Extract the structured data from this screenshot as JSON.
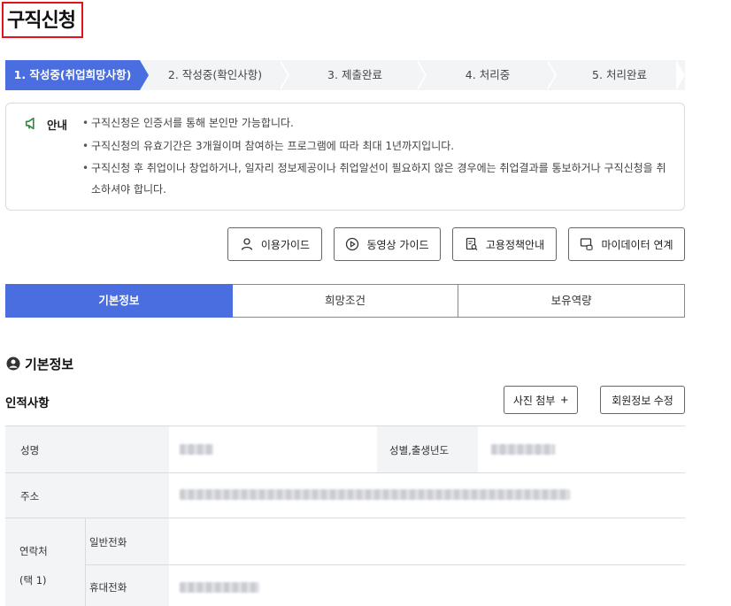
{
  "page": {
    "title": "구직신청"
  },
  "steps": [
    {
      "label": "1. 작성중(취업희망사항)",
      "active": true
    },
    {
      "label": "2. 작성중(확인사항)",
      "active": false
    },
    {
      "label": "3. 제출완료",
      "active": false
    },
    {
      "label": "4. 처리중",
      "active": false
    },
    {
      "label": "5. 처리완료",
      "active": false
    }
  ],
  "notice": {
    "label": "안내",
    "items": [
      "구직신청은 인증서를 통해 본인만 가능합니다.",
      "구직신청의 유효기간은 3개월이며 참여하는 프로그램에 따라 최대 1년까지입니다.",
      "구직신청 후 취업이나 창업하거나, 일자리 정보제공이나 취업알선이 필요하지 않은 경우에는 취업결과를 통보하거나 구직신청을 취",
      "소하셔야 합니다."
    ]
  },
  "guide_buttons": {
    "usage": "이용가이드",
    "video": "동영상 가이드",
    "policy": "고용정책안내",
    "mydata": "마이데이터 연계"
  },
  "tabs": [
    {
      "label": "기본정보",
      "active": true
    },
    {
      "label": "희망조건",
      "active": false
    },
    {
      "label": "보유역량",
      "active": false
    }
  ],
  "section": {
    "title": "기본정보",
    "subtitle": "인적사항",
    "photo_button": "사진 첨부",
    "photo_plus": "+",
    "edit_button": "회원정보 수정"
  },
  "table": {
    "name_label": "성명",
    "gender_label": "성별,출생년도",
    "address_label": "주소",
    "contact_label": "연락처",
    "contact_note": "(택 1)",
    "phone_label": "일반전화",
    "mobile_label": "휴대전화"
  },
  "colors": {
    "accent": "#4a6ee0",
    "highlight_border": "#e0141e",
    "notice_icon": "#2e8b3d"
  }
}
